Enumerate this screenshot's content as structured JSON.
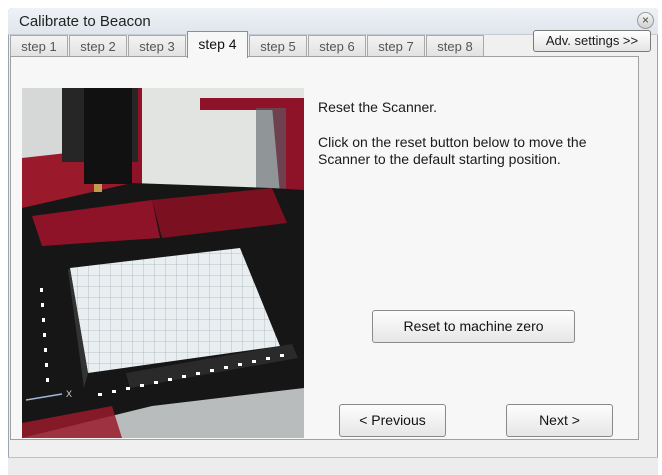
{
  "window": {
    "title": "Calibrate to Beacon",
    "close_label": "×"
  },
  "tabs": [
    {
      "label": "step 1"
    },
    {
      "label": "step 2"
    },
    {
      "label": "step 3"
    },
    {
      "label": "step 4",
      "active": true
    },
    {
      "label": "step 5"
    },
    {
      "label": "step 6"
    },
    {
      "label": "step 7"
    },
    {
      "label": "step 8"
    }
  ],
  "adv_settings_label": "Adv. settings >>",
  "instructions": {
    "heading": "Reset the Scanner.",
    "body": "Click on the reset button below to move the Scanner to the default starting position."
  },
  "buttons": {
    "reset": "Reset to machine zero",
    "previous": "< Previous",
    "next": "Next >"
  },
  "photo": {
    "axis_label": "X"
  },
  "colors": {
    "machine_red": "#8e1228",
    "bed_black": "#161616",
    "grid": "#e6ebee"
  }
}
